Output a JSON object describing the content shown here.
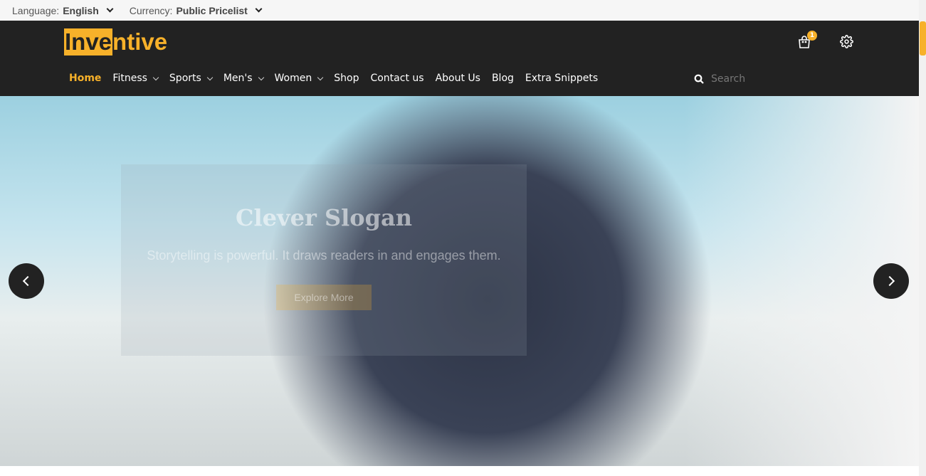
{
  "topbar": {
    "language_label": "Language:",
    "language_value": "English",
    "currency_label": "Currency:",
    "currency_value": "Public Pricelist"
  },
  "header": {
    "logo_highlight": "Inve",
    "logo_rest": "ntive",
    "cart_count": "1"
  },
  "nav": {
    "items": [
      {
        "label": "Home"
      },
      {
        "label": "Fitness"
      },
      {
        "label": "Sports"
      },
      {
        "label": "Men's"
      },
      {
        "label": "Women"
      },
      {
        "label": "Shop"
      },
      {
        "label": "Contact us"
      },
      {
        "label": "About Us"
      },
      {
        "label": "Blog"
      },
      {
        "label": "Extra Snippets"
      }
    ],
    "search_placeholder": "Search"
  },
  "hero": {
    "title": "Clever Slogan",
    "subtitle": "Storytelling is powerful. It draws readers in and engages them.",
    "button": "Explore More"
  },
  "colors": {
    "accent": "#f7b12a",
    "header": "#222222"
  }
}
